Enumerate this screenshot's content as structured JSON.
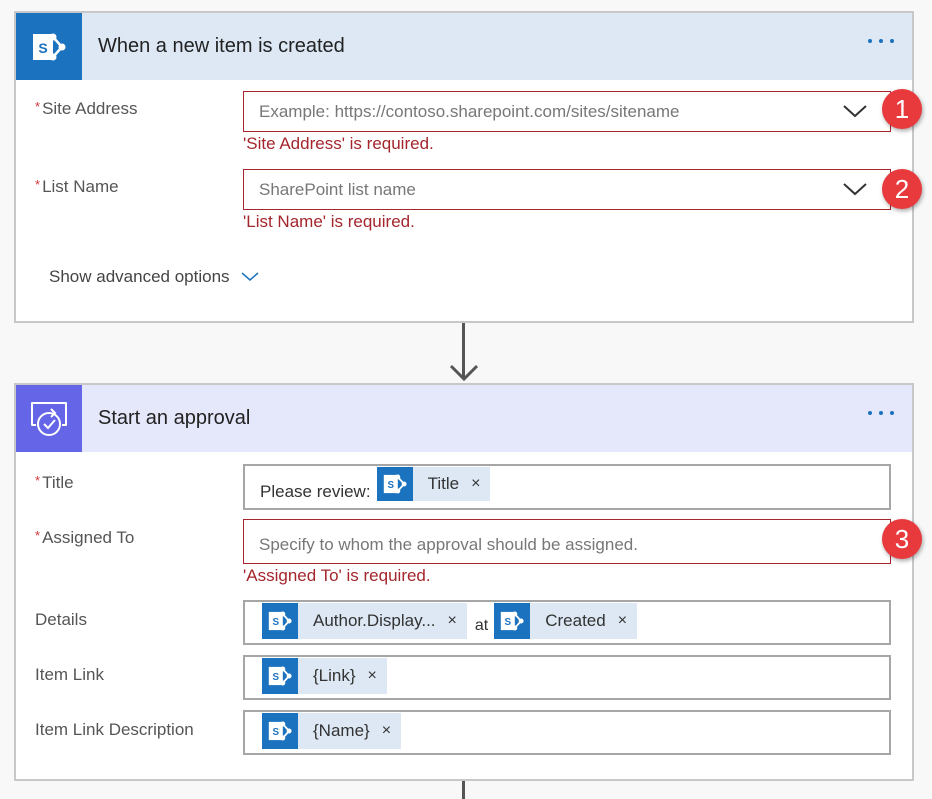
{
  "trigger": {
    "title": "When a new item is created",
    "icon": "sharepoint-icon",
    "more_label": "more-options",
    "fields": {
      "site_address": {
        "label": "Site Address",
        "required_mark": "*",
        "placeholder": "Example: https://contoso.sharepoint.com/sites/sitename",
        "error": "'Site Address' is required.",
        "badge": "1"
      },
      "list_name": {
        "label": "List Name",
        "required_mark": "*",
        "placeholder": "SharePoint list name",
        "error": "'List Name' is required.",
        "badge": "2"
      }
    },
    "advanced_label": "Show advanced options"
  },
  "approval": {
    "title": "Start an approval",
    "icon": "approval-icon",
    "fields": {
      "title": {
        "label": "Title",
        "required_mark": "*",
        "prefix_text": "Please review:",
        "tokens": [
          "Title"
        ]
      },
      "assigned_to": {
        "label": "Assigned To",
        "required_mark": "*",
        "placeholder": "Specify to whom the approval should be assigned.",
        "error": "'Assigned To' is required.",
        "badge": "3"
      },
      "details": {
        "label": "Details",
        "tokens": [
          "Author.Display...",
          "Created"
        ],
        "joiner": "at"
      },
      "item_link": {
        "label": "Item Link",
        "tokens": [
          "{Link}"
        ]
      },
      "item_link_description": {
        "label": "Item Link Description",
        "tokens": [
          "{Name}"
        ]
      }
    }
  },
  "token_remove_glyph": "×",
  "colors": {
    "sharepoint": "#1b72bf",
    "approval": "#6565e8",
    "error": "#a4262c",
    "badge": "#e8393c"
  }
}
